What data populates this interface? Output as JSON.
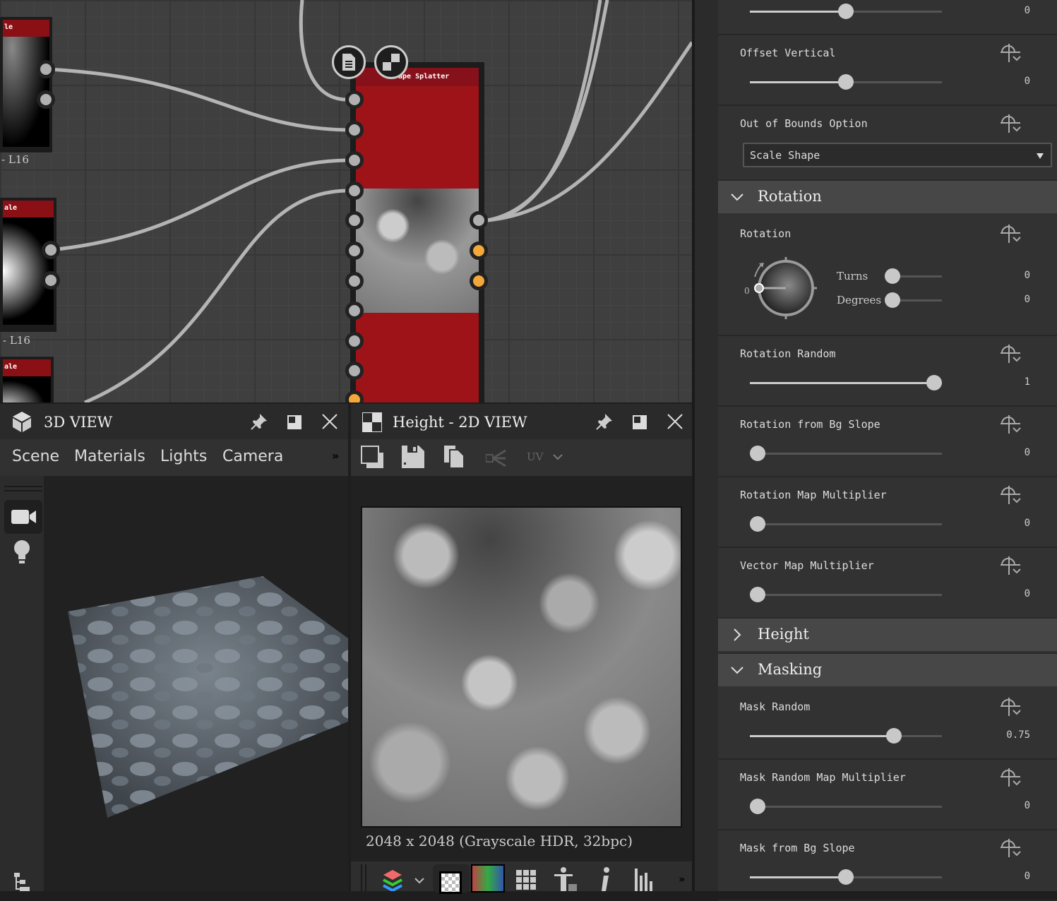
{
  "graph": {
    "nodes": [
      {
        "title": "le",
        "footer": "- L16"
      },
      {
        "title": "ale",
        "footer": "- L16"
      },
      {
        "title": "ale"
      }
    ],
    "main_node": {
      "title": "ape Splatter",
      "header_color": "#9e1318"
    },
    "port_colors": {
      "input": "#b0b0b0",
      "output_alt": "#f5a83a"
    }
  },
  "view3d": {
    "title": "3D VIEW",
    "tabs": [
      "Scene",
      "Materials",
      "Lights",
      "Camera"
    ],
    "overflow": "»",
    "icons": [
      "cube-icon",
      "pin-icon",
      "maximize-icon",
      "close-icon",
      "camera-icon",
      "light-bulb-icon",
      "hierarchy-icon"
    ]
  },
  "view2d": {
    "title": "Height - 2D VIEW",
    "uv_label": "UV",
    "info": "2048 x 2048 (Grayscale HDR, 32bpc)",
    "overflow": "»",
    "toolbar_icons": [
      "view-icon",
      "save-icon",
      "copy-icon",
      "share-icon"
    ],
    "bottom_icons": [
      "layers-icon",
      "checker-icon",
      "color-gradient-icon",
      "grid-icon",
      "figure-icon",
      "info-icon",
      "histogram-icon"
    ]
  },
  "panel": {
    "params": [
      {
        "label": "",
        "value": "0",
        "fill": 0.5
      },
      {
        "label": "Offset Vertical",
        "value": "0",
        "fill": 0.5
      },
      {
        "label": "Out of Bounds Option",
        "select": "Scale Shape"
      },
      {
        "label": "Rotation",
        "turns_label": "Turns",
        "turns_value": "0",
        "degrees_label": "Degrees",
        "degrees_value": "0",
        "dial_zero": "0"
      },
      {
        "label": "Rotation Random",
        "value": "1",
        "fill": 1.0
      },
      {
        "label": "Rotation from Bg Slope",
        "value": "0",
        "fill": 0
      },
      {
        "label": "Rotation Map Multiplier",
        "value": "0",
        "fill": 0
      },
      {
        "label": "Vector Map Multiplier",
        "value": "0",
        "fill": 0
      },
      {
        "label": "Mask Random",
        "value": "0.75",
        "fill": 0.75
      },
      {
        "label": "Mask Random Map Multiplier",
        "value": "0",
        "fill": 0
      },
      {
        "label": "Mask from Bg Slope",
        "value": "0",
        "fill": 0.5
      }
    ],
    "sections": [
      {
        "title": "Rotation",
        "expanded": true
      },
      {
        "title": "Height",
        "expanded": false
      },
      {
        "title": "Masking",
        "expanded": true
      }
    ]
  }
}
